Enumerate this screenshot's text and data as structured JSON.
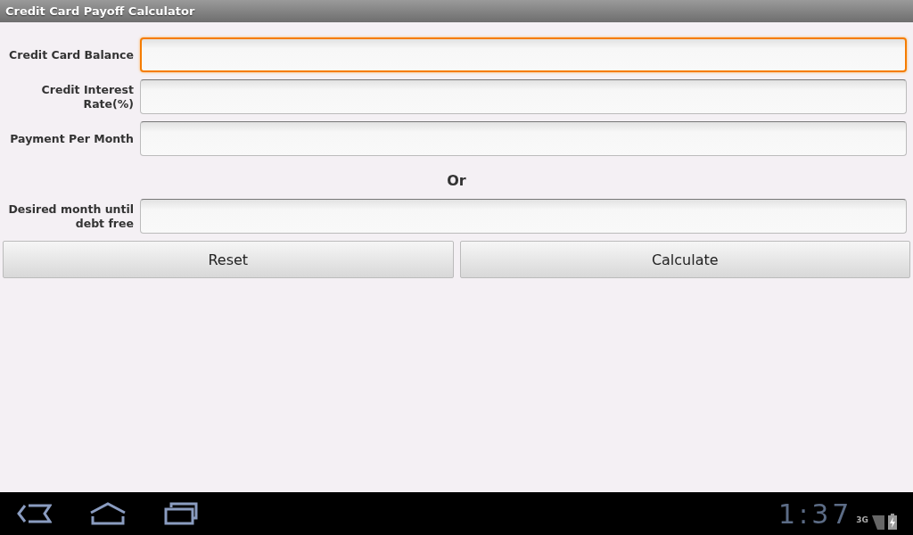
{
  "window": {
    "title": "Credit Card Payoff Calculator"
  },
  "fields": [
    {
      "label": "Credit Card Balance",
      "focused": true
    },
    {
      "label": "Credit Interest Rate(%)",
      "focused": false
    },
    {
      "label": "Payment Per Month",
      "focused": false
    }
  ],
  "separator": "Or",
  "extra_fields": [
    {
      "label": "Desired month until debt free",
      "focused": false
    }
  ],
  "buttons": [
    "Reset",
    "Calculate"
  ],
  "status_bar": {
    "time": "1:37",
    "network": "3G"
  }
}
